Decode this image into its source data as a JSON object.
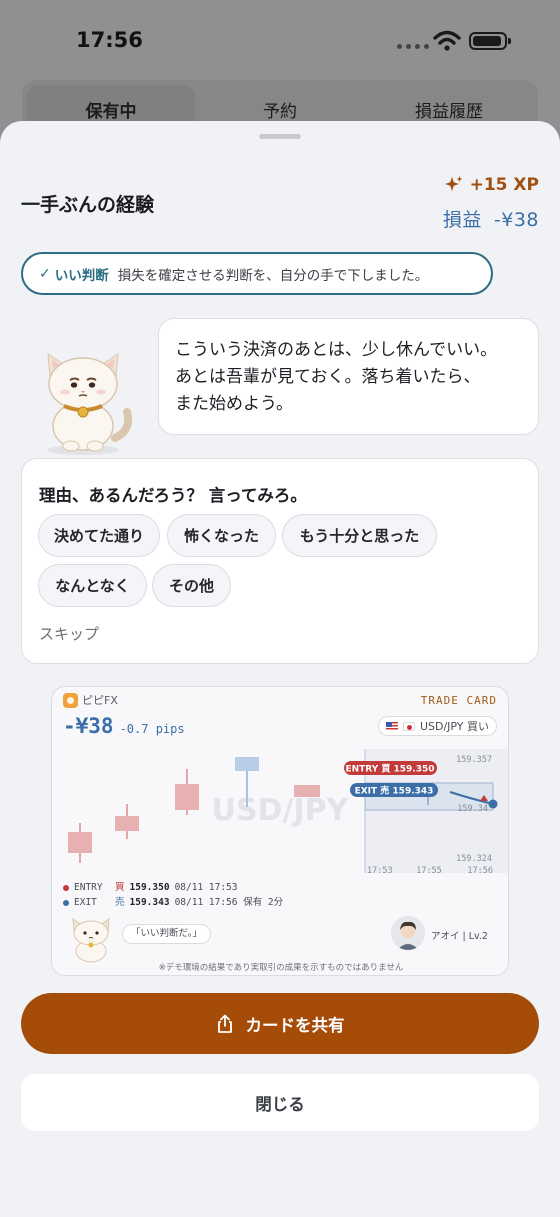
{
  "status_bar": {
    "time": "17:56"
  },
  "bg_tabs": {
    "items": [
      "保有中",
      "予約",
      "損益履歴"
    ]
  },
  "sheet": {
    "title": "一手ぶんの経験",
    "xp": "+15 XP",
    "pnl_label": "損益",
    "pnl_value": "-¥38",
    "judgement": {
      "tag": "いい判断",
      "message": "損失を確定させる判断を、自分の手で下しました。"
    },
    "cat_message": [
      "こういう決済のあとは、少し休んでいい。",
      "あとは吾輩が見ておく。落ち着いたら、",
      "また始めよう。"
    ],
    "reason": {
      "question": "理由、あるんだろう？ 言ってみろ。",
      "options": [
        "決めてた通り",
        "怖くなった",
        "もう十分と思った",
        "なんとなく",
        "その他"
      ],
      "skip": "スキップ"
    },
    "card": {
      "brand": "ピピFX",
      "label": "TRADE CARD",
      "pl": "-¥38",
      "pips": "-0.7 pips",
      "pair": "USD/JPY 買い",
      "watermark": "USD/JPY",
      "entry_tag": "ENTRY 買 159.350",
      "exit_tag": "EXIT 売 159.343",
      "price_top": "159.357",
      "price_mid": "159.34",
      "price_bottom": "159.324",
      "time_ticks": [
        "17:53",
        "17:55",
        "17:56"
      ],
      "legend": [
        {
          "label": "ENTRY",
          "side": "買",
          "price": "159.350",
          "meta": "08/11 17:53",
          "color": "#c23a3a"
        },
        {
          "label": "EXIT",
          "side": "売",
          "price": "159.343",
          "meta": "08/11 17:56  保有 2分",
          "color": "#3c6ea8"
        }
      ],
      "quote": "「いい判断だ。」",
      "user": "アオイ  |  Lv.2",
      "disclaimer": "※デモ環境の結果であり実取引の成果を示すものではありません"
    },
    "share_label": "カードを共有",
    "close_label": "閉じる"
  },
  "colors": {
    "accent": "#a44c08",
    "loss": "#3c6ea8",
    "good": "#2c6e84"
  }
}
